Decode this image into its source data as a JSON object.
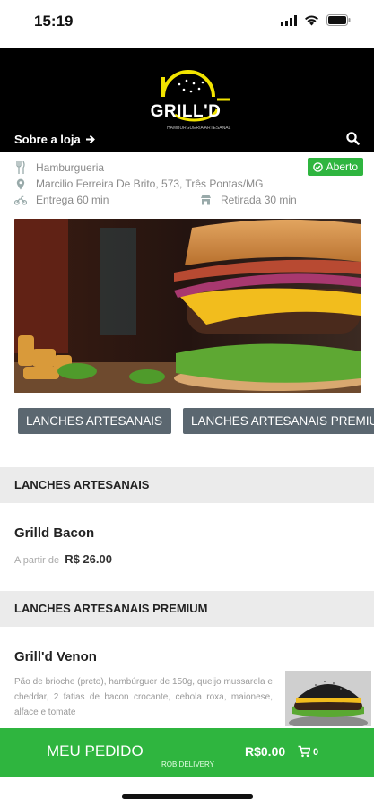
{
  "status_bar": {
    "time": "15:19"
  },
  "header": {
    "logo_text": "GRILL'D",
    "logo_subtitle": "HAMBURGUERIA ARTESANAL",
    "about_link": "Sobre a loja",
    "search_icon": "search-icon"
  },
  "store_info": {
    "category": "Hamburgueria",
    "address": "Marcilio Ferreira De Brito, 573, Três Pontas/MG",
    "delivery": "Entrega 60 min",
    "pickup": "Retirada 30 min",
    "status_badge": "Aberto",
    "colors": {
      "open": "#2fb53f"
    }
  },
  "categories": [
    {
      "label": "LANCHES ARTESANAIS"
    },
    {
      "label": "LANCHES ARTESANAIS PREMIUM"
    }
  ],
  "sections": [
    {
      "title": "LANCHES ARTESANAIS",
      "products": [
        {
          "name": "Grilld Bacon",
          "price_prefix": "A partir de",
          "price": "R$ 26.00"
        }
      ]
    },
    {
      "title": "LANCHES ARTESANAIS PREMIUM",
      "products": [
        {
          "name": "Grill'd Venon",
          "description": "Pão de brioche (preto), hambúrguer de 150g, queijo mussarela e cheddar, 2 fatias de bacon crocante, cebola roxa, maionese, alface e tomate"
        }
      ]
    }
  ],
  "cart": {
    "label": "MEU PEDIDO",
    "provider": "ROB DELIVERY",
    "total": "R$0.00",
    "count": "0",
    "color": "#2fb53f"
  }
}
